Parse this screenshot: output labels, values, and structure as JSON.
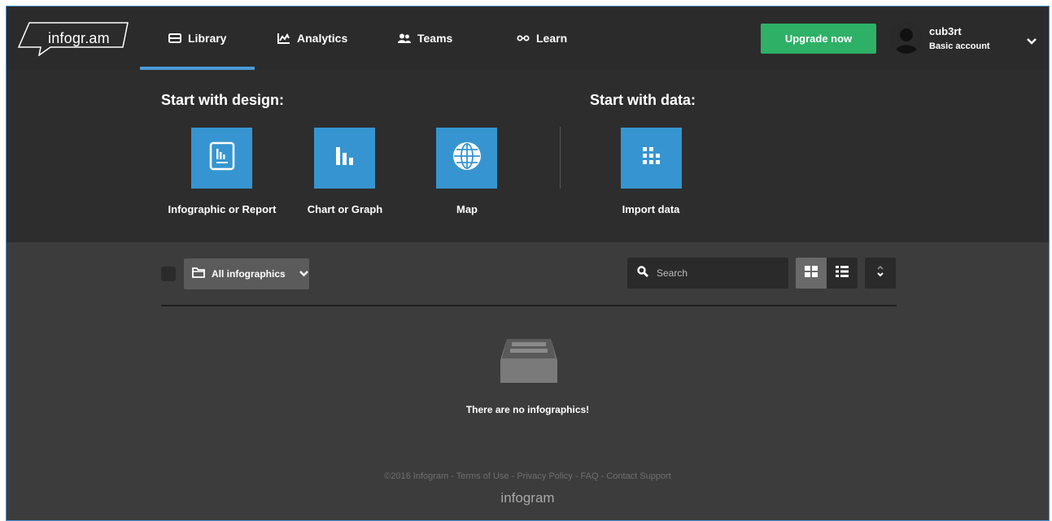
{
  "brand": {
    "logo_text": "infogr.am"
  },
  "nav": {
    "items": [
      {
        "label": "Library",
        "icon": "library-icon",
        "active": true
      },
      {
        "label": "Analytics",
        "icon": "analytics-icon",
        "active": false
      },
      {
        "label": "Teams",
        "icon": "teams-icon",
        "active": false
      },
      {
        "label": "Learn",
        "icon": "learn-icon",
        "active": false
      }
    ],
    "accent_color": "#4a9ad6"
  },
  "header": {
    "upgrade_label": "Upgrade now",
    "upgrade_color": "#2eb067",
    "user": {
      "name": "cub3rt",
      "plan": "Basic account"
    }
  },
  "create": {
    "design_title": "Start with design:",
    "data_title": "Start with data:",
    "tile_color": "#3695d0",
    "tiles": [
      {
        "label": "Infographic or Report",
        "icon": "report-icon"
      },
      {
        "label": "Chart or Graph",
        "icon": "bar-chart-icon"
      },
      {
        "label": "Map",
        "icon": "globe-icon"
      },
      {
        "label": "Import data",
        "icon": "grid-dots-icon"
      }
    ]
  },
  "library": {
    "folder_select_value": "All infographics",
    "search_placeholder": "Search",
    "empty_message": "There are no infographics!"
  },
  "footer": {
    "links_text": "©2016 Infogram - Terms of Use - Privacy Policy - FAQ - Contact Support",
    "logo_text": "infogram"
  }
}
